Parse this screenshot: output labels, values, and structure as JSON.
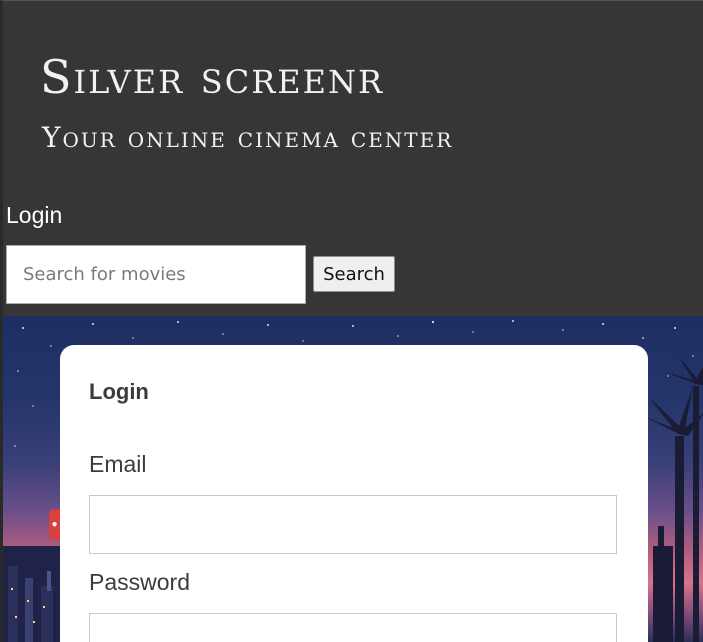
{
  "header": {
    "site_title": "Silver screenr",
    "site_subtitle": "Your online cinema center",
    "nav_login": "Login",
    "search": {
      "placeholder": "Search for movies",
      "value": "",
      "button_label": "Search"
    }
  },
  "login_form": {
    "title": "Login",
    "email_label": "Email",
    "email_value": "",
    "password_label": "Password",
    "password_value": ""
  },
  "overlays": {
    "password_manager_icon": "password-manager-icon",
    "password_manager_text": "•••|",
    "password_manager_color": "#d94040"
  },
  "colors": {
    "header_bg": "#363636",
    "header_text": "#f2f2f2",
    "card_bg": "#ffffff"
  }
}
